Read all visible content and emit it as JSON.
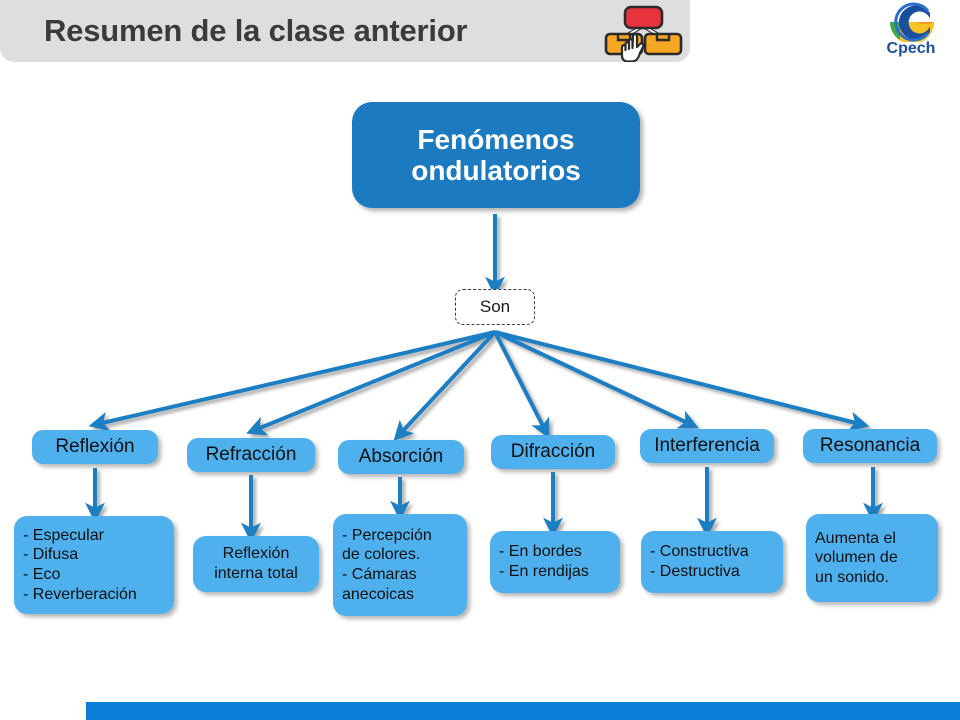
{
  "header": {
    "title": "Resumen de la clase anterior",
    "icon_name": "flowchart-hand-icon",
    "band_color": "#dedede",
    "title_color": "#3b3b3b"
  },
  "logo": {
    "text": "Cpech",
    "icon_name": "cpech-logo-icon",
    "blue": "#1a4fa0",
    "orange": "#f0901e",
    "yellow": "#f6c425",
    "green": "#3faa4a"
  },
  "colors": {
    "root_blue": "#1B7AC0",
    "node_blue": "#4FB0EE",
    "arrow_blue": "#1e7fc4",
    "bottom_bar": "#0b7dd6"
  },
  "diagram": {
    "root": {
      "label": "Fenómenos ondulatorios"
    },
    "connector": {
      "label": "Son"
    },
    "categories": [
      {
        "label": "Reflexión",
        "detail": "- Especular\n- Difusa\n- Eco\n- Reverberación",
        "detail_align": "left"
      },
      {
        "label": "Refracción",
        "detail": "Reflexión\ninterna total",
        "detail_align": "center"
      },
      {
        "label": "Absorción",
        "detail": "- Percepción\nde colores.\n- Cámaras\nanecoicas",
        "detail_align": "left"
      },
      {
        "label": "Difracción",
        "detail": "- En bordes\n- En rendijas",
        "detail_align": "left"
      },
      {
        "label": "Interferencia",
        "detail": "- Constructiva\n- Destructiva",
        "detail_align": "left"
      },
      {
        "label": "Resonancia",
        "detail": "Aumenta el\nvolumen de\nun sonido.",
        "detail_align": "left"
      }
    ]
  }
}
